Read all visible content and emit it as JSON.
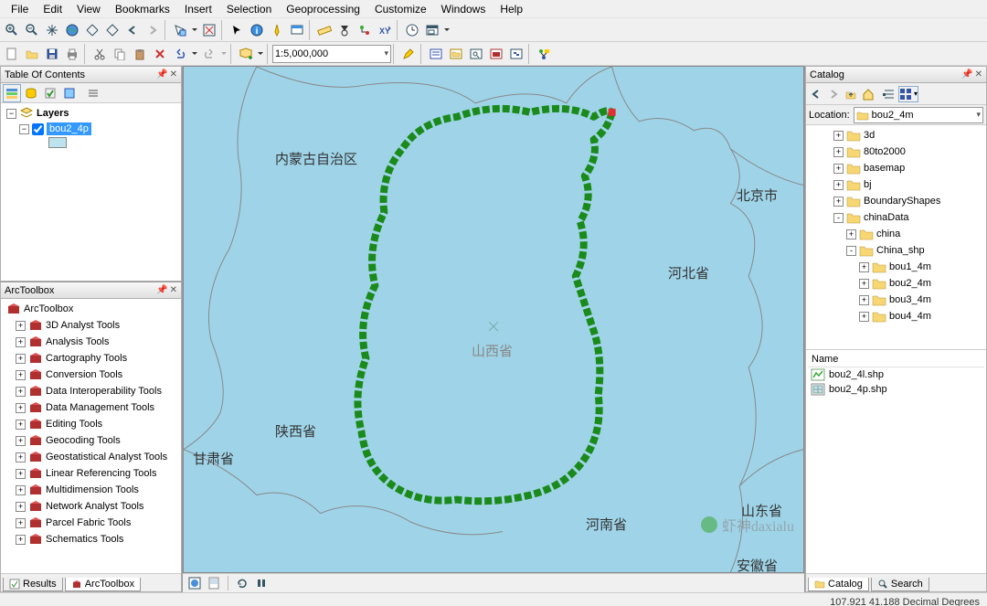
{
  "menu": [
    "File",
    "Edit",
    "View",
    "Bookmarks",
    "Insert",
    "Selection",
    "Geoprocessing",
    "Customize",
    "Windows",
    "Help"
  ],
  "scale": "1:5,000,000",
  "toc": {
    "title": "Table Of Contents",
    "root": "Layers",
    "layer": "bou2_4p"
  },
  "toolbox": {
    "title": "ArcToolbox",
    "root": "ArcToolbox",
    "items": [
      "3D Analyst Tools",
      "Analysis Tools",
      "Cartography Tools",
      "Conversion Tools",
      "Data Interoperability Tools",
      "Data Management Tools",
      "Editing Tools",
      "Geocoding Tools",
      "Geostatistical Analyst Tools",
      "Linear Referencing Tools",
      "Multidimension Tools",
      "Network Analyst Tools",
      "Parcel Fabric Tools",
      "Schematics Tools"
    ]
  },
  "bot_tabs": {
    "results": "Results",
    "arctoolbox": "ArcToolbox"
  },
  "map_labels": {
    "neimenggu": "内蒙古自治区",
    "beijing": "北京市",
    "hebei": "河北省",
    "shanxi_center": "山西省",
    "shaanxi": "陕西省",
    "gansu": "甘肃省",
    "henan": "河南省",
    "shandong": "山东省",
    "anhui": "安徽省"
  },
  "catalog": {
    "title": "Catalog",
    "location_label": "Location:",
    "location_value": "bou2_4m",
    "tree": [
      {
        "ind": 2,
        "exp": "+",
        "t": "folder",
        "label": "3d"
      },
      {
        "ind": 2,
        "exp": "+",
        "t": "folder",
        "label": "80to2000"
      },
      {
        "ind": 2,
        "exp": "+",
        "t": "folder",
        "label": "basemap"
      },
      {
        "ind": 2,
        "exp": "+",
        "t": "folder",
        "label": "bj"
      },
      {
        "ind": 2,
        "exp": "+",
        "t": "folder",
        "label": "BoundaryShapes"
      },
      {
        "ind": 2,
        "exp": "-",
        "t": "folder",
        "label": "chinaData"
      },
      {
        "ind": 3,
        "exp": "+",
        "t": "folder",
        "label": "china"
      },
      {
        "ind": 3,
        "exp": "-",
        "t": "folder",
        "label": "China_shp"
      },
      {
        "ind": 4,
        "exp": "+",
        "t": "folder",
        "label": "bou1_4m"
      },
      {
        "ind": 4,
        "exp": "+",
        "t": "folder",
        "label": "bou2_4m"
      },
      {
        "ind": 4,
        "exp": "+",
        "t": "folder",
        "label": "bou3_4m"
      },
      {
        "ind": 4,
        "exp": "+",
        "t": "folder",
        "label": "bou4_4m"
      }
    ],
    "contents_hdr": "Name",
    "contents": [
      {
        "icon": "line",
        "label": "bou2_4l.shp"
      },
      {
        "icon": "poly",
        "label": "bou2_4p.shp"
      }
    ],
    "tabs": {
      "catalog": "Catalog",
      "search": "Search"
    }
  },
  "status": {
    "coords": "107.921  41.188 Decimal Degrees"
  },
  "watermark": "虾神daxialu"
}
